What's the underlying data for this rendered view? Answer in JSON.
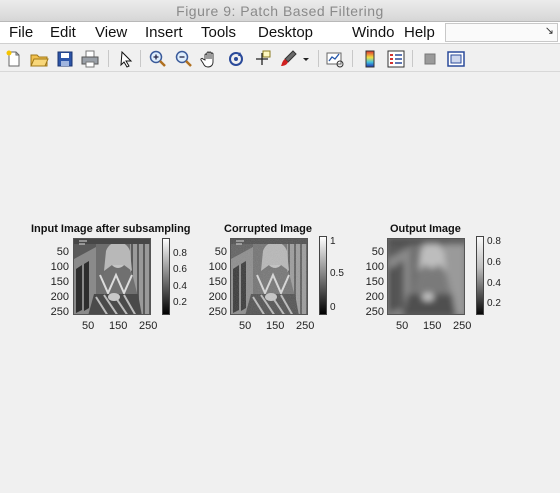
{
  "window": {
    "title": "Figure 9: Patch Based Filtering"
  },
  "menu": {
    "items": [
      "File",
      "Edit",
      "View",
      "Insert",
      "Tools",
      "Desktop",
      "Windo",
      "Help"
    ],
    "dock_icon": "↘"
  },
  "toolbar": {
    "icons": [
      "new-figure-icon",
      "open-file-icon",
      "save-icon",
      "print-icon",
      "edit-pointer-icon",
      "zoom-in-icon",
      "zoom-out-icon",
      "pan-hand-icon",
      "rotate-3d-icon",
      "data-cursor-icon",
      "brush-icon",
      "brush-dropdown-icon",
      "link-plot-icon",
      "colorbar-icon",
      "legend-icon",
      "hide-plot-tools-icon",
      "show-plot-tools-icon"
    ]
  },
  "axes": [
    {
      "title": "Input Image after subsampling",
      "y_ticks": [
        "50",
        "100",
        "150",
        "200",
        "250"
      ],
      "x_ticks": [
        "50",
        "150",
        "250"
      ],
      "colorbar_ticks": [
        "0.8",
        "0.6",
        "0.4",
        "0.2"
      ]
    },
    {
      "title": "Corrupted Image",
      "y_ticks": [
        "50",
        "100",
        "150",
        "200",
        "250"
      ],
      "x_ticks": [
        "50",
        "150",
        "250"
      ],
      "colorbar_ticks": [
        "1",
        "0.5",
        "0"
      ]
    },
    {
      "title": "Output Image",
      "y_ticks": [
        "50",
        "100",
        "150",
        "200",
        "250"
      ],
      "x_ticks": [
        "50",
        "150",
        "250"
      ],
      "colorbar_ticks": [
        "0.8",
        "0.6",
        "0.4",
        "0.2"
      ]
    }
  ]
}
